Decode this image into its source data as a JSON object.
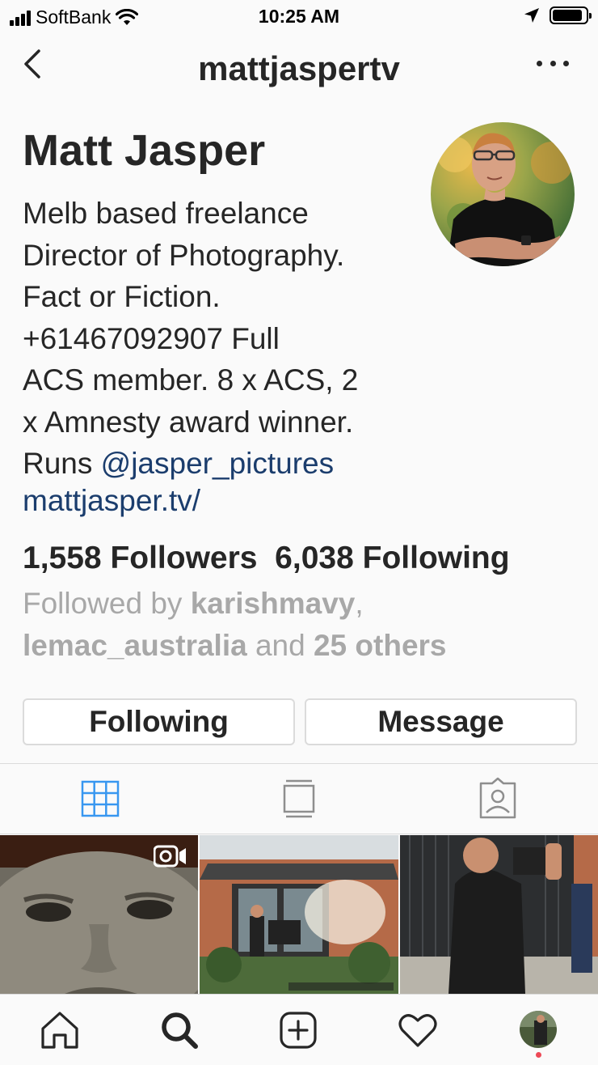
{
  "status_bar": {
    "carrier": "SoftBank",
    "time": "10:25 AM",
    "battery_level": 0.9
  },
  "header": {
    "username": "mattjaspertv"
  },
  "profile": {
    "full_name": "Matt Jasper",
    "bio_lines": [
      "Melb based freelance",
      "Director of Photography.",
      "Fact or Fiction.",
      "+61467092907 Full",
      "ACS member. 8 x ACS, 2",
      "x Amnesty award winner."
    ],
    "bio_runs_prefix": "Runs ",
    "bio_mention": "@jasper_pictures",
    "website": "mattjasper.tv/",
    "followers_count": "1,558",
    "followers_label": "Followers",
    "following_count": "6,038",
    "following_label": "Following",
    "followed_by_prefix": "Followed by ",
    "followed_by_user1": "karishmavy",
    "followed_by_sep": ",",
    "followed_by_user2": "lemac_australia",
    "followed_by_and": " and ",
    "followed_by_others": "25 others"
  },
  "actions": {
    "following_label": "Following",
    "message_label": "Message"
  },
  "tabs": [
    "grid-icon",
    "feed-icon",
    "tagged-icon"
  ],
  "bottom_nav": [
    "home-icon",
    "search-icon",
    "add-icon",
    "heart-icon",
    "profile-avatar"
  ],
  "colors": {
    "accent_blue": "#3897f0",
    "link_blue": "#1b3d6d",
    "muted_gray": "#a8a8a8",
    "notification_red": "#ed4956"
  }
}
